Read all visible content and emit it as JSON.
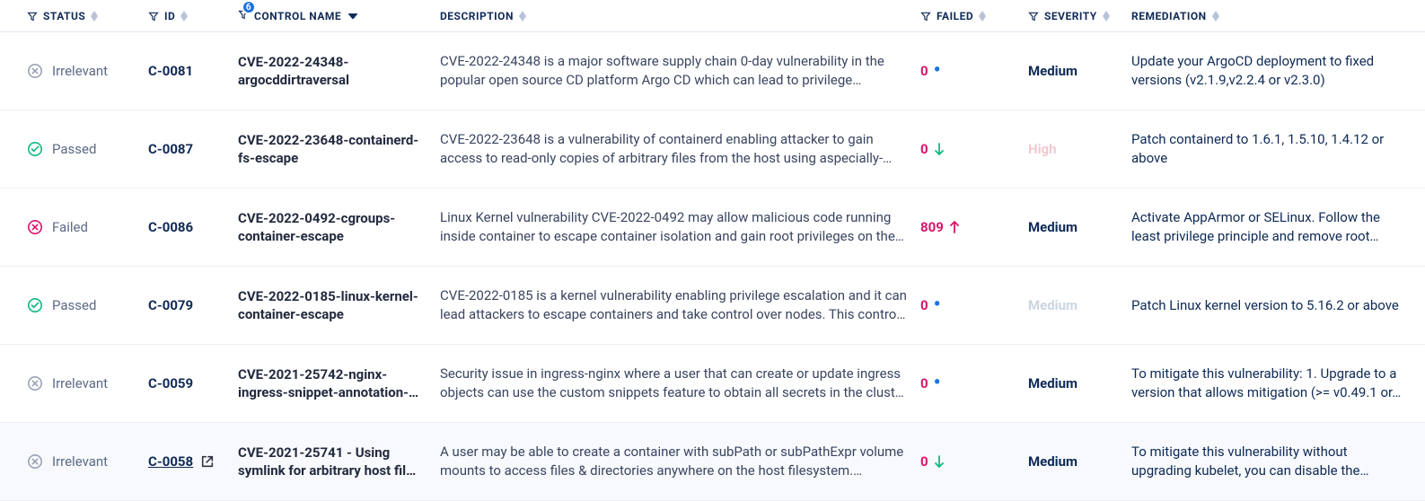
{
  "headers": {
    "status": "Status",
    "id": "ID",
    "control_name": "Control Name",
    "control_name_badge": "6",
    "description": "Description",
    "failed": "Failed",
    "severity": "Severity",
    "remediation": "Remediation"
  },
  "rows": [
    {
      "status": "Irrelevant",
      "status_kind": "irrelevant",
      "id": "C-0081",
      "id_underline": false,
      "show_ext_link": false,
      "name": "CVE-2022-24348-argocddirtraversal",
      "description": "CVE-2022-24348 is a major software supply chain 0-day vulnerability in the popular open source CD platform Argo CD which can lead to privilege…",
      "failed_count": "0",
      "failed_trend": "dot-blue",
      "severity": "Medium",
      "severity_class": "sev-medium",
      "remediation": "Update your ArgoCD deployment to fixed versions (v2.1.9,v2.2.4 or v2.3.0)"
    },
    {
      "status": "Passed",
      "status_kind": "passed",
      "id": "C-0087",
      "id_underline": false,
      "show_ext_link": false,
      "name": "CVE-2022-23648-containerd-fs-escape",
      "description": "CVE-2022-23648 is a vulnerability of containerd enabling attacker to gain access to read-only copies of arbitrary files from the host using aspecially-…",
      "failed_count": "0",
      "failed_trend": "arrow-down-green",
      "severity": "High",
      "severity_class": "sev-high-dim",
      "remediation": "Patch containerd to 1.6.1, 1.5.10, 1.4.12 or above"
    },
    {
      "status": "Failed",
      "status_kind": "failed",
      "id": "C-0086",
      "id_underline": false,
      "show_ext_link": false,
      "name": "CVE-2022-0492-cgroups-container-escape",
      "description": "Linux Kernel vulnerability CVE-2022-0492 may allow malicious code running inside container to escape container isolation and gain root privileges on the…",
      "failed_count": "809",
      "failed_trend": "arrow-up-pink",
      "severity": "Medium",
      "severity_class": "sev-medium",
      "remediation": "Activate AppArmor or SELinux. Follow the least privilege principle and remove root…"
    },
    {
      "status": "Passed",
      "status_kind": "passed",
      "id": "C-0079",
      "id_underline": false,
      "show_ext_link": false,
      "name": "CVE-2022-0185-linux-kernel-container-escape",
      "description": "CVE-2022-0185 is a kernel vulnerability enabling privilege escalation and it can lead attackers to escape containers and take control over nodes. This contro…",
      "failed_count": "0",
      "failed_trend": "dot-blue",
      "severity": "Medium",
      "severity_class": "sev-medium-dim",
      "remediation": "Patch Linux kernel version to 5.16.2 or above"
    },
    {
      "status": "Irrelevant",
      "status_kind": "irrelevant",
      "id": "C-0059",
      "id_underline": false,
      "show_ext_link": false,
      "name": "CVE-2021-25742-nginx-ingress-snippet-annotation-…",
      "description": "Security issue in ingress-nginx where a user that can create or update ingress objects can use the custom snippets feature to obtain all secrets in the clust…",
      "failed_count": "0",
      "failed_trend": "dot-blue",
      "severity": "Medium",
      "severity_class": "sev-medium",
      "remediation": "To mitigate this vulnerability: 1. Upgrade to a version that allows mitigation (>= v0.49.1 or…"
    },
    {
      "status": "Irrelevant",
      "status_kind": "irrelevant",
      "id": "C-0058",
      "id_underline": true,
      "show_ext_link": true,
      "name": "CVE-2021-25741 - Using symlink for arbitrary host fil…",
      "description": "A user may be able to create a container with subPath or subPathExpr volume mounts to access files & directories anywhere on the host filesystem.…",
      "failed_count": "0",
      "failed_trend": "arrow-down-green",
      "severity": "Medium",
      "severity_class": "sev-medium",
      "remediation": "To mitigate this vulnerability without upgrading kubelet, you can disable the…",
      "hovered": true
    }
  ]
}
